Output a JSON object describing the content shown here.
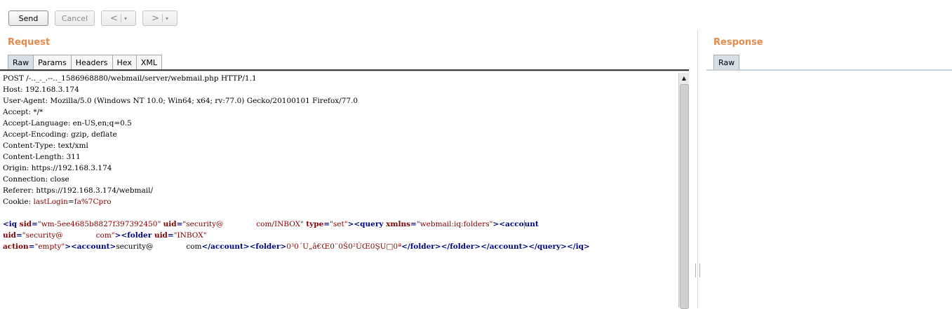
{
  "toolbar": {
    "send_label": "Send",
    "cancel_label": "Cancel",
    "back_label": "<",
    "forward_label": ">",
    "dropdown_caret": "▾"
  },
  "request": {
    "title": "Request",
    "tabs": [
      "Raw",
      "Params",
      "Headers",
      "Hex",
      "XML"
    ],
    "active_tab": "Raw",
    "lines": [
      "POST /-.._._.--.._1586968880/webmail/server/webmail.php HTTP/1.1",
      "Host: 192.168.3.174",
      "User-Agent: Mozilla/5.0 (Windows NT 10.0; Win64; x64; rv:77.0) Gecko/20100101 Firefox/77.0",
      "Accept: */*",
      "Accept-Language: en-US,en;q=0.5",
      "Accept-Encoding: gzip, deflate",
      "Content-Type: text/xml",
      "Content-Length: 311",
      "Origin: https://192.168.3.174",
      "Connection: close",
      "Referer: https://192.168.3.174/webmail/"
    ],
    "cookie": {
      "label": "Cookie: ",
      "name": "lastLogin",
      "eq": "=",
      "value": "fa%7Cpro"
    },
    "body": {
      "l1_open": "<iq ",
      "l1_sid_attr": "sid",
      "l1_sid_val": "\"wm-5ee4685b8827f397392450\"",
      "l1_uid_attr": "uid",
      "l1_uid_val": "\"security@              com/INBOX\"",
      "l1_type_attr": "type",
      "l1_type_val": "\"set\"",
      "l1_query": "><query ",
      "l1_xmlns_attr": "xmlns",
      "l1_xmlns_val": "\"webmail:iq:folders\"",
      "l1_acc_a": "><acco",
      "l1_acc_b": "unt",
      "l2_uid_attr": "uid",
      "l2_uid_val": "\"security@              com\"",
      "l2_folder": "><folder ",
      "l2_uid2_attr": "uid",
      "l2_uid2_val": "\"INBOX\"",
      "l3_action_attr": "action",
      "l3_action_val": "\"empty\"",
      "l3_account_open": "><account>",
      "l3_email": "security@              com",
      "l3_account_close_folder": "</account><folder>",
      "l3_garble": "0³0´U„â€Œ0¨0Š0²ÚŒ0ŞU□0ª",
      "l3_close": "</folder></folder></account></query></iq>"
    }
  },
  "response": {
    "title": "Response",
    "tabs": [
      "Raw"
    ],
    "active_tab": "Raw"
  },
  "colors": {
    "section_title": "#e58a4e",
    "xml_tag": "#000080",
    "xml_attr": "#800000",
    "cursor": "#e36a1a",
    "active_tab": "#d6dee6"
  }
}
